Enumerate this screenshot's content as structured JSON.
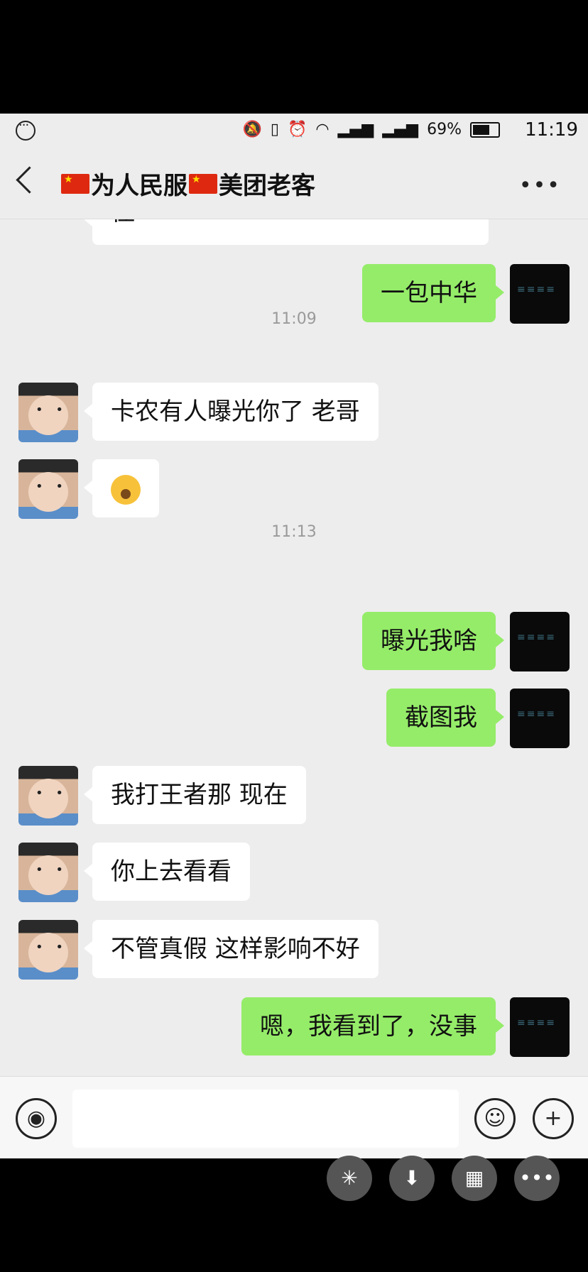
{
  "status_bar": {
    "battery_percent_text": "69%",
    "battery_level": 0.69,
    "time": "11:19",
    "icons": [
      "more-dots-icon",
      "mute-icon",
      "vibrate-off-icon",
      "alarm-icon",
      "wifi-icon",
      "signal-icon",
      "signal-icon",
      "battery-icon"
    ]
  },
  "header": {
    "title_part1": "为人民服",
    "title_part2": "美团老客",
    "flag_icon": "china-flag-icon",
    "back_icon": "chevron-left-icon",
    "more_icon": "more-horizontal-icon"
  },
  "messages": {
    "cut_off_text": "住",
    "m1": "一包中华",
    "ts1": "11:09",
    "m2": "卡农有人曝光你了  老哥",
    "m3_emoji": "zipper-mouth-emoji",
    "ts2": "11:13",
    "m4": "曝光我啥",
    "m5": "截图我",
    "m6": "我打王者那  现在",
    "m7": "你上去看看",
    "m8": "不管真假  这样影响不好",
    "m9": "嗯，我看到了，没事"
  },
  "input_bar": {
    "voice_icon": "voice-icon",
    "emoji_icon": "emoji-icon",
    "plus_icon": "plus-icon",
    "text_value": ""
  },
  "floating_buttons": {
    "icons": [
      "pinwheel-icon",
      "download-icon",
      "grid-icon",
      "more-dots-icon"
    ]
  },
  "colors": {
    "chat_bg": "#ededed",
    "outgoing_bubble": "#95ec69",
    "incoming_bubble": "#ffffff"
  }
}
